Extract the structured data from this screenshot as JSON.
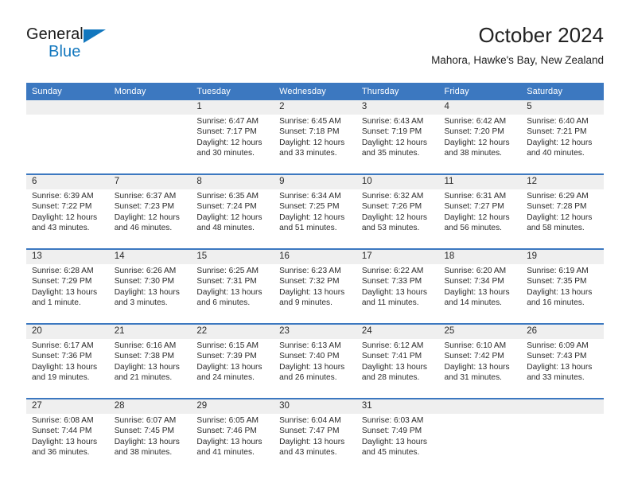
{
  "brand": {
    "name_part1": "General",
    "name_part2": "Blue",
    "triangle_icon": "triangle-icon"
  },
  "header": {
    "title": "October 2024",
    "subtitle": "Mahora, Hawke's Bay, New Zealand"
  },
  "colors": {
    "header_blue": "#3c78c0",
    "brand_blue": "#1277be",
    "date_band_gray": "#efefef",
    "text": "#2b2b2b"
  },
  "weekday_headers": [
    "Sunday",
    "Monday",
    "Tuesday",
    "Wednesday",
    "Thursday",
    "Friday",
    "Saturday"
  ],
  "weeks": [
    [
      {
        "day": "",
        "lines": []
      },
      {
        "day": "",
        "lines": []
      },
      {
        "day": "1",
        "lines": [
          "Sunrise: 6:47 AM",
          "Sunset: 7:17 PM",
          "Daylight: 12 hours",
          "and 30 minutes."
        ]
      },
      {
        "day": "2",
        "lines": [
          "Sunrise: 6:45 AM",
          "Sunset: 7:18 PM",
          "Daylight: 12 hours",
          "and 33 minutes."
        ]
      },
      {
        "day": "3",
        "lines": [
          "Sunrise: 6:43 AM",
          "Sunset: 7:19 PM",
          "Daylight: 12 hours",
          "and 35 minutes."
        ]
      },
      {
        "day": "4",
        "lines": [
          "Sunrise: 6:42 AM",
          "Sunset: 7:20 PM",
          "Daylight: 12 hours",
          "and 38 minutes."
        ]
      },
      {
        "day": "5",
        "lines": [
          "Sunrise: 6:40 AM",
          "Sunset: 7:21 PM",
          "Daylight: 12 hours",
          "and 40 minutes."
        ]
      }
    ],
    [
      {
        "day": "6",
        "lines": [
          "Sunrise: 6:39 AM",
          "Sunset: 7:22 PM",
          "Daylight: 12 hours",
          "and 43 minutes."
        ]
      },
      {
        "day": "7",
        "lines": [
          "Sunrise: 6:37 AM",
          "Sunset: 7:23 PM",
          "Daylight: 12 hours",
          "and 46 minutes."
        ]
      },
      {
        "day": "8",
        "lines": [
          "Sunrise: 6:35 AM",
          "Sunset: 7:24 PM",
          "Daylight: 12 hours",
          "and 48 minutes."
        ]
      },
      {
        "day": "9",
        "lines": [
          "Sunrise: 6:34 AM",
          "Sunset: 7:25 PM",
          "Daylight: 12 hours",
          "and 51 minutes."
        ]
      },
      {
        "day": "10",
        "lines": [
          "Sunrise: 6:32 AM",
          "Sunset: 7:26 PM",
          "Daylight: 12 hours",
          "and 53 minutes."
        ]
      },
      {
        "day": "11",
        "lines": [
          "Sunrise: 6:31 AM",
          "Sunset: 7:27 PM",
          "Daylight: 12 hours",
          "and 56 minutes."
        ]
      },
      {
        "day": "12",
        "lines": [
          "Sunrise: 6:29 AM",
          "Sunset: 7:28 PM",
          "Daylight: 12 hours",
          "and 58 minutes."
        ]
      }
    ],
    [
      {
        "day": "13",
        "lines": [
          "Sunrise: 6:28 AM",
          "Sunset: 7:29 PM",
          "Daylight: 13 hours",
          "and 1 minute."
        ]
      },
      {
        "day": "14",
        "lines": [
          "Sunrise: 6:26 AM",
          "Sunset: 7:30 PM",
          "Daylight: 13 hours",
          "and 3 minutes."
        ]
      },
      {
        "day": "15",
        "lines": [
          "Sunrise: 6:25 AM",
          "Sunset: 7:31 PM",
          "Daylight: 13 hours",
          "and 6 minutes."
        ]
      },
      {
        "day": "16",
        "lines": [
          "Sunrise: 6:23 AM",
          "Sunset: 7:32 PM",
          "Daylight: 13 hours",
          "and 9 minutes."
        ]
      },
      {
        "day": "17",
        "lines": [
          "Sunrise: 6:22 AM",
          "Sunset: 7:33 PM",
          "Daylight: 13 hours",
          "and 11 minutes."
        ]
      },
      {
        "day": "18",
        "lines": [
          "Sunrise: 6:20 AM",
          "Sunset: 7:34 PM",
          "Daylight: 13 hours",
          "and 14 minutes."
        ]
      },
      {
        "day": "19",
        "lines": [
          "Sunrise: 6:19 AM",
          "Sunset: 7:35 PM",
          "Daylight: 13 hours",
          "and 16 minutes."
        ]
      }
    ],
    [
      {
        "day": "20",
        "lines": [
          "Sunrise: 6:17 AM",
          "Sunset: 7:36 PM",
          "Daylight: 13 hours",
          "and 19 minutes."
        ]
      },
      {
        "day": "21",
        "lines": [
          "Sunrise: 6:16 AM",
          "Sunset: 7:38 PM",
          "Daylight: 13 hours",
          "and 21 minutes."
        ]
      },
      {
        "day": "22",
        "lines": [
          "Sunrise: 6:15 AM",
          "Sunset: 7:39 PM",
          "Daylight: 13 hours",
          "and 24 minutes."
        ]
      },
      {
        "day": "23",
        "lines": [
          "Sunrise: 6:13 AM",
          "Sunset: 7:40 PM",
          "Daylight: 13 hours",
          "and 26 minutes."
        ]
      },
      {
        "day": "24",
        "lines": [
          "Sunrise: 6:12 AM",
          "Sunset: 7:41 PM",
          "Daylight: 13 hours",
          "and 28 minutes."
        ]
      },
      {
        "day": "25",
        "lines": [
          "Sunrise: 6:10 AM",
          "Sunset: 7:42 PM",
          "Daylight: 13 hours",
          "and 31 minutes."
        ]
      },
      {
        "day": "26",
        "lines": [
          "Sunrise: 6:09 AM",
          "Sunset: 7:43 PM",
          "Daylight: 13 hours",
          "and 33 minutes."
        ]
      }
    ],
    [
      {
        "day": "27",
        "lines": [
          "Sunrise: 6:08 AM",
          "Sunset: 7:44 PM",
          "Daylight: 13 hours",
          "and 36 minutes."
        ]
      },
      {
        "day": "28",
        "lines": [
          "Sunrise: 6:07 AM",
          "Sunset: 7:45 PM",
          "Daylight: 13 hours",
          "and 38 minutes."
        ]
      },
      {
        "day": "29",
        "lines": [
          "Sunrise: 6:05 AM",
          "Sunset: 7:46 PM",
          "Daylight: 13 hours",
          "and 41 minutes."
        ]
      },
      {
        "day": "30",
        "lines": [
          "Sunrise: 6:04 AM",
          "Sunset: 7:47 PM",
          "Daylight: 13 hours",
          "and 43 minutes."
        ]
      },
      {
        "day": "31",
        "lines": [
          "Sunrise: 6:03 AM",
          "Sunset: 7:49 PM",
          "Daylight: 13 hours",
          "and 45 minutes."
        ]
      },
      {
        "day": "",
        "lines": []
      },
      {
        "day": "",
        "lines": []
      }
    ]
  ]
}
